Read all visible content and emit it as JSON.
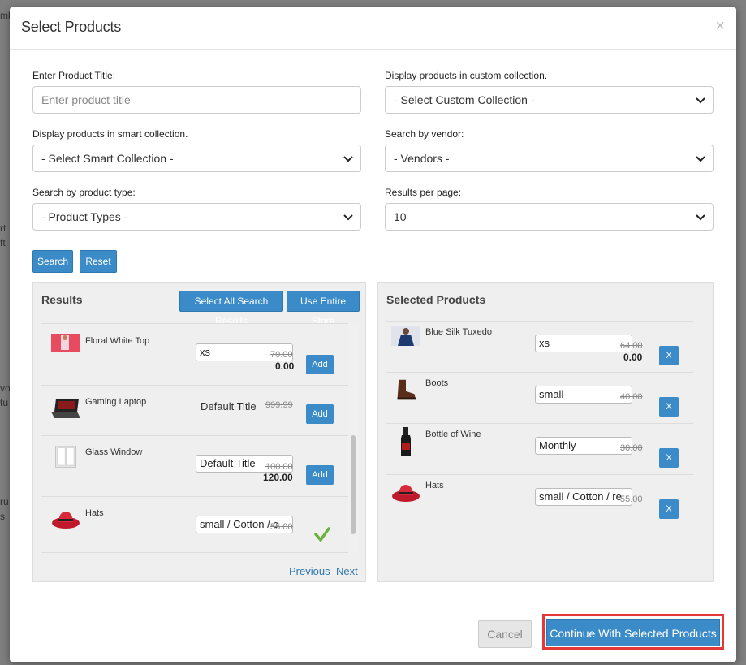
{
  "modal": {
    "title": "Select Products",
    "close_symbol": "×"
  },
  "form": {
    "product_title_label": "Enter Product Title:",
    "product_title_placeholder": "Enter product title",
    "custom_collection_label": "Display products in custom collection.",
    "custom_collection_value": "- Select Custom Collection -",
    "smart_collection_label": "Display products in smart collection.",
    "smart_collection_value": "- Select Smart Collection -",
    "vendor_label": "Search by vendor:",
    "vendor_value": "- Vendors -",
    "product_type_label": "Search by product type:",
    "product_type_value": "- Product Types -",
    "results_per_page_label": "Results per page:",
    "results_per_page_value": "10",
    "search_button": "Search",
    "reset_button": "Reset"
  },
  "results": {
    "title": "Results",
    "select_all_button": "Select All Search Results",
    "use_entire_store_button": "Use Entire Store",
    "items": [
      {
        "name": "Floral White Top",
        "variant": "xs",
        "old_price": "70.00",
        "price": "0.00",
        "action": "Add"
      },
      {
        "name": "Gaming Laptop",
        "variant": "Default Title",
        "old_price": "999.99",
        "price": "",
        "action": "Add"
      },
      {
        "name": "Glass Window",
        "variant": "Default Title",
        "old_price": "100.00",
        "price": "120.00",
        "action": "Add"
      },
      {
        "name": "Hats",
        "variant": "small / Cotton / c",
        "old_price": "55.00",
        "price": "",
        "action": "added"
      }
    ],
    "previous": "Previous",
    "next": "Next"
  },
  "selected": {
    "title": "Selected Products",
    "items": [
      {
        "name": "Blue Silk Tuxedo",
        "variant": "xs",
        "old_price": "64.00",
        "price": "0.00",
        "remove": "X"
      },
      {
        "name": "Boots",
        "variant": "small",
        "old_price": "40.00",
        "price": "",
        "remove": "X"
      },
      {
        "name": "Bottle of Wine",
        "variant": "Monthly",
        "old_price": "30.00",
        "price": "",
        "remove": "X"
      },
      {
        "name": "Hats",
        "variant": "small / Cotton / re",
        "old_price": "55.00",
        "price": "",
        "remove": "X"
      }
    ]
  },
  "footer": {
    "cancel": "Cancel",
    "continue": "Continue With Selected Products"
  },
  "backdrop": {
    "fragments": [
      "mb",
      "rt",
      "ft",
      "vo",
      "tu",
      "ru",
      "s"
    ]
  }
}
